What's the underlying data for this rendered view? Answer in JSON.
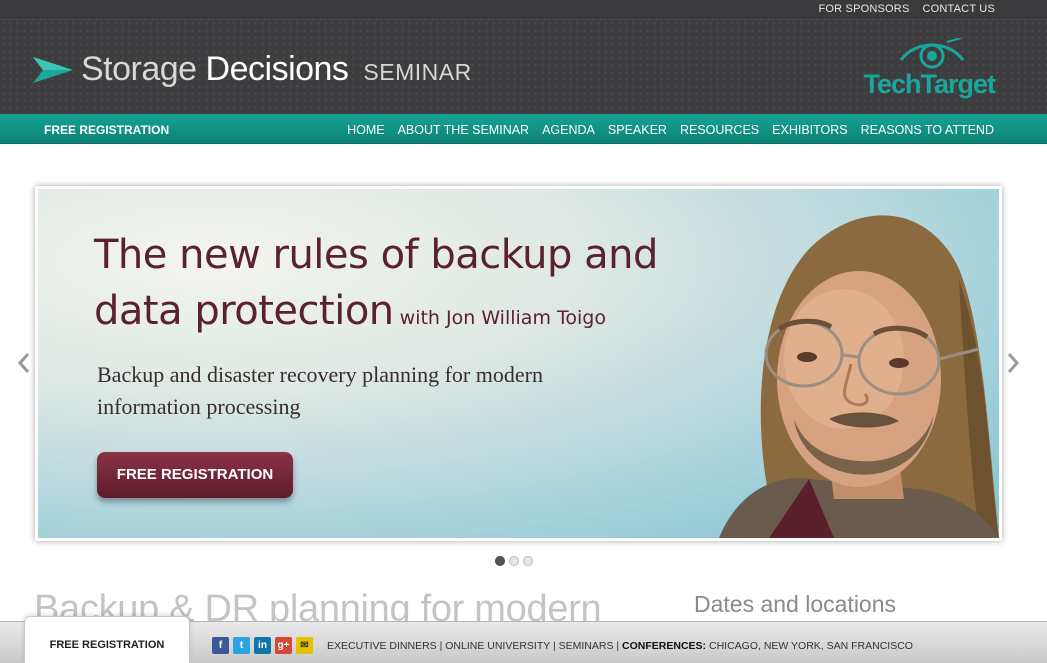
{
  "topbar": {
    "links": [
      "FOR SPONSORS",
      "CONTACT US"
    ]
  },
  "header": {
    "logo_part1": "Storage",
    "logo_part2": "Decisions",
    "logo_part3": "SEMINAR",
    "brand": "TechTarget"
  },
  "nav": {
    "registration": "FREE REGISTRATION",
    "items": [
      "HOME",
      "ABOUT THE SEMINAR",
      "AGENDA",
      "SPEAKER",
      "RESOURCES",
      "EXHIBITORS",
      "REASONS TO ATTEND"
    ]
  },
  "hero": {
    "title_line1": "The new rules of backup and",
    "title_line2": "data protection",
    "with_speaker": "with Jon William Toigo",
    "subtitle": "Backup and disaster recovery planning for modern information processing",
    "button": "FREE REGISTRATION",
    "active_slide": 1,
    "slide_count": 3
  },
  "content": {
    "main_heading": "Backup & DR planning for modern",
    "side_heading": "Dates and locations"
  },
  "bottombar": {
    "registration": "FREE REGISTRATION",
    "social_icons": [
      "facebook-icon",
      "twitter-icon",
      "linkedin-icon",
      "googleplus-icon",
      "email-icon"
    ],
    "links_plain": "EXECUTIVE DINNERS | ONLINE UNIVERSITY | SEMINARS | ",
    "conferences_label": "CONFERENCES:",
    "conferences_list": " CHICAGO, NEW YORK, SAN FRANCISCO"
  },
  "colors": {
    "teal": "#13998c",
    "maroon": "#5a2131",
    "header_dark": "#3d3d40"
  }
}
